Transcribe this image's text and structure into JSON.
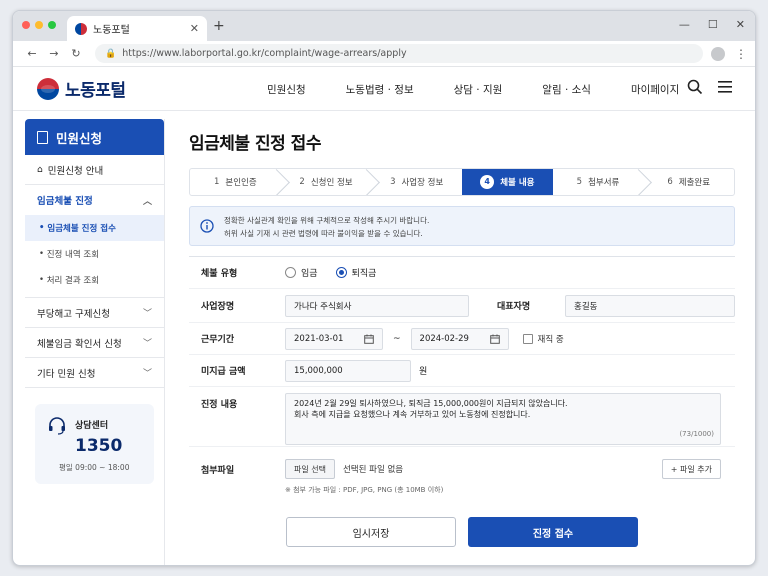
{
  "browser": {
    "tab_title": "노동포털",
    "url": "https://www.laborportal.go.kr/complaint/wage-arrears/apply",
    "colors": {
      "close": "#ff5f57",
      "min": "#febc2e",
      "max": "#28c840"
    }
  },
  "header": {
    "logo_text": "노동포털",
    "nav": [
      "민원신청",
      "노동법령 · 정보",
      "상담 · 지원",
      "알림 · 소식",
      "마이페이지"
    ]
  },
  "sidebar": {
    "title": "민원신청",
    "guide": "민원신청 안내",
    "group": "임금체불 진정",
    "subs": [
      "임금체불 진정 접수",
      "진정 내역 조회",
      "처리 결과 조회"
    ],
    "items": [
      "부당해고 구제신청",
      "체불임금 확인서 신청",
      "기타 민원 신청"
    ],
    "consult": {
      "title": "상담센터",
      "number": "1350",
      "hours": "평일 09:00 ~ 18:00"
    }
  },
  "main": {
    "title": "임금체불 진정 접수",
    "steps": [
      {
        "n": "1",
        "label": "본인인증"
      },
      {
        "n": "2",
        "label": "신청인 정보"
      },
      {
        "n": "3",
        "label": "사업장 정보"
      },
      {
        "n": "4",
        "label": "체불 내용"
      },
      {
        "n": "5",
        "label": "첨부서류"
      },
      {
        "n": "6",
        "label": "제출완료"
      }
    ],
    "active_step": 4,
    "notice": [
      "정확한 사실관계 확인을 위해 구체적으로 작성해 주시기 바랍니다.",
      "허위 사실 기재 시 관련 법령에 따라 불이익을 받을 수 있습니다."
    ],
    "form": {
      "type_label": "체불 유형",
      "type_opt1": "임금",
      "type_opt2": "퇴직금",
      "type_selected": "퇴직금",
      "biz_label": "사업장명",
      "biz_value": "가나다 주식회사",
      "ceo_label": "대표자명",
      "ceo_value": "홍길동",
      "period_label": "근무기간",
      "period_start": "2021-03-01",
      "period_tilde": "~",
      "period_end": "2024-02-29",
      "employed_label": "재직 중",
      "amount_label": "미지급 금액",
      "amount_value": "15,000,000",
      "amount_unit": "원",
      "content_label": "진정 내용",
      "content_line1": "2024년 2월 29일 퇴사하였으나, 퇴직금 15,000,000원이 지급되지 않았습니다.",
      "content_line2": "회사 측에 지급을 요청했으나 계속 거부하고 있어 노동청에 진정합니다.",
      "content_count": "(73/1000)",
      "file_label": "첨부파일",
      "file_button": "파일 선택",
      "file_status": "선택된 파일 없음",
      "file_add": "+ 파일 추가",
      "file_note": "※ 첨부 가능 파일 : PDF, JPG, PNG (총 10MB 이하)"
    },
    "actions": {
      "save": "임시저장",
      "submit": "진정 접수"
    }
  }
}
